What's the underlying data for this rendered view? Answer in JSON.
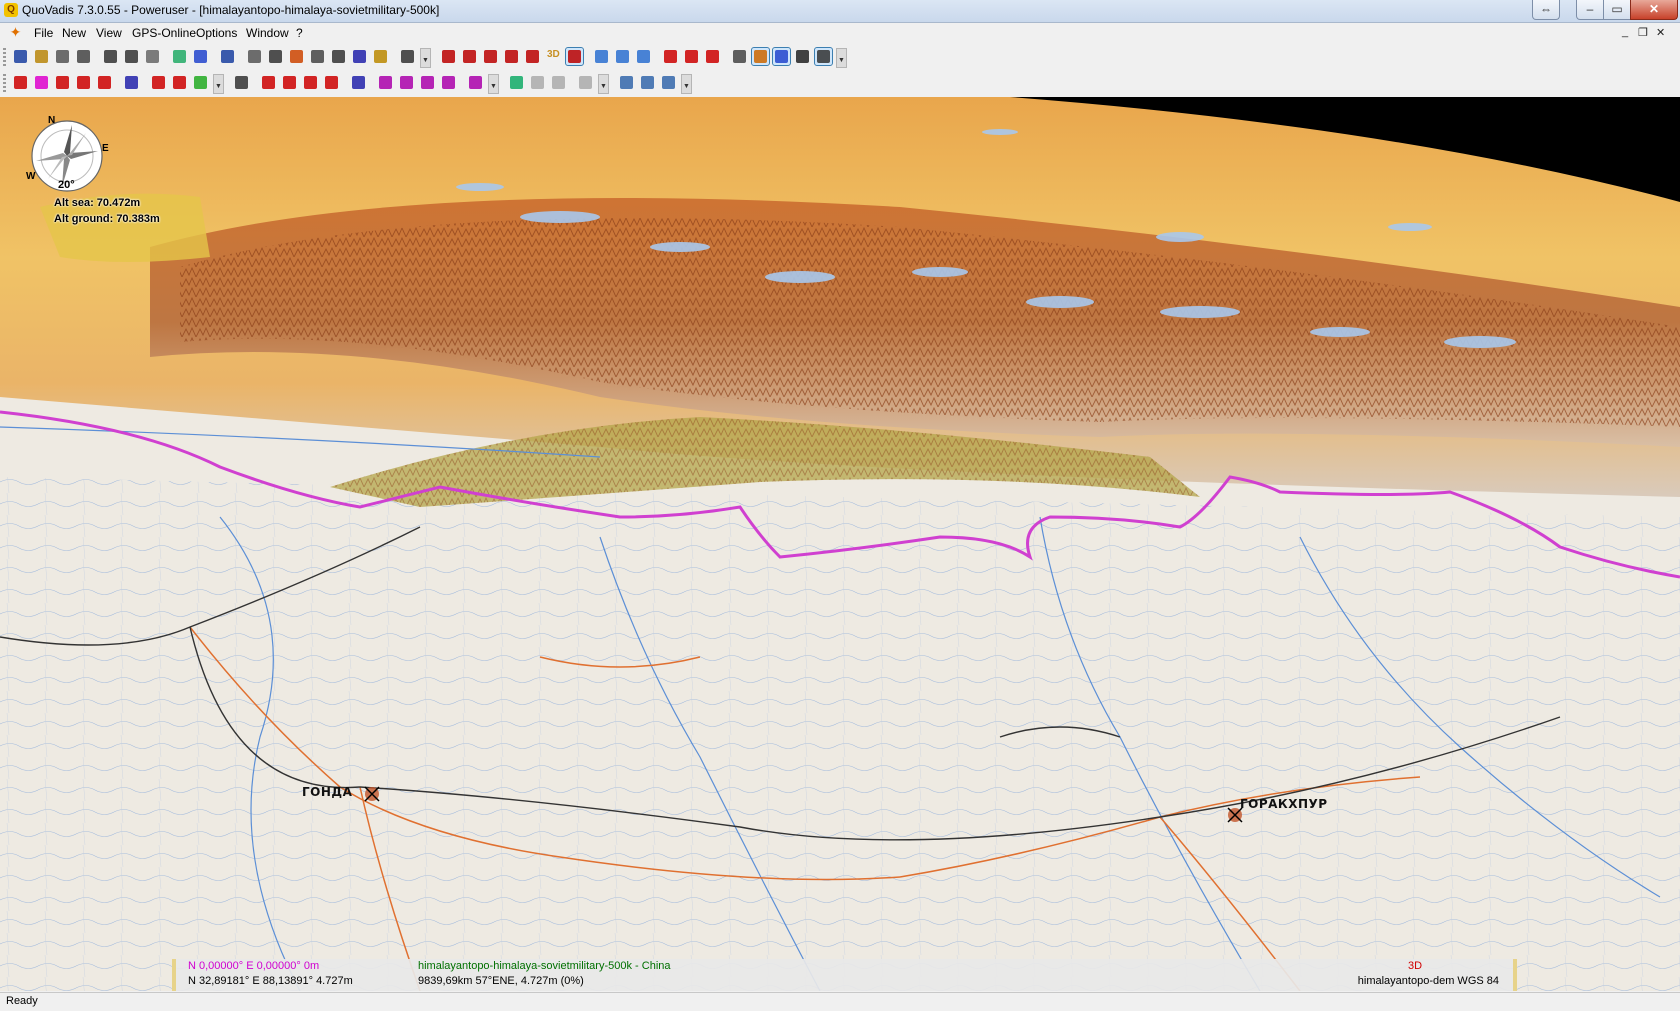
{
  "window": {
    "title": "QuoVadis 7.3.0.55 - Poweruser - [himalayantopo-himalaya-sovietmilitary-500k]",
    "controls": {
      "restore_ext": "⇔",
      "minimize": "–",
      "maximize": "▭",
      "close": "✕"
    }
  },
  "menu": {
    "items": [
      "File",
      "New",
      "View",
      "GPS-Online",
      "Options",
      "Window",
      "?"
    ],
    "mdi_controls": [
      "_",
      "❐",
      "✕"
    ]
  },
  "toolbar1": {
    "buttons": [
      {
        "icon": "delete-x-icon",
        "color": "#1a3fa0"
      },
      {
        "icon": "database-icon",
        "color": "#b8860b"
      },
      {
        "icon": "copy-icon",
        "color": "#555"
      },
      {
        "icon": "print-icon",
        "color": "#444"
      },
      {
        "icon": "binoculars-icon",
        "color": "#333"
      },
      {
        "icon": "binoculars-search-icon",
        "color": "#333"
      },
      {
        "icon": "export-icon",
        "color": "#666"
      },
      {
        "icon": "terrain-icon",
        "color": "#2a6"
      },
      {
        "icon": "dice-icon",
        "color": "#24c"
      },
      {
        "icon": "target-icon",
        "color": "#1a3fa0"
      },
      {
        "icon": "list-icon",
        "color": "#555"
      },
      {
        "icon": "layers-icon",
        "color": "#333"
      },
      {
        "icon": "route-icon",
        "color": "#c40"
      },
      {
        "icon": "clock-icon",
        "color": "#444"
      },
      {
        "icon": "notes-icon",
        "color": "#333"
      },
      {
        "icon": "gps-icon",
        "color": "#22a"
      },
      {
        "icon": "ruler-icon",
        "color": "#b80"
      },
      {
        "icon": "tools-icon",
        "color": "#333"
      },
      {
        "icon": "zoom-in-icon",
        "color": "#b00"
      },
      {
        "icon": "zoom-out-icon",
        "color": "#b00"
      },
      {
        "icon": "zoom-fit-icon",
        "color": "#b00"
      },
      {
        "icon": "zoom-window-icon",
        "color": "#b00"
      },
      {
        "icon": "zoom-reset-icon",
        "color": "#b00"
      },
      {
        "icon": "3d-icon",
        "color": "#c08000"
      },
      {
        "icon": "zoom-active-icon",
        "color": "#b00"
      },
      {
        "icon": "back-icon",
        "color": "#2a6fd0"
      },
      {
        "icon": "forward-icon",
        "color": "#2a6fd0"
      },
      {
        "icon": "download-icon",
        "color": "#2a6fd0"
      },
      {
        "icon": "add-marker-icon",
        "color": "#c00"
      },
      {
        "icon": "remove-marker-icon",
        "color": "#c00"
      },
      {
        "icon": "edit-marker-icon",
        "color": "#c00"
      },
      {
        "icon": "person-icon",
        "color": "#444"
      },
      {
        "icon": "draw-icon",
        "color": "#c60"
      },
      {
        "icon": "compass-icon",
        "color": "#24c"
      },
      {
        "icon": "grid-icon",
        "color": "#222"
      },
      {
        "icon": "window-icon",
        "color": "#333"
      }
    ]
  },
  "toolbar2": {
    "buttons": [
      {
        "icon": "waypoint-icon",
        "color": "#c00"
      },
      {
        "icon": "waypoint-edit-icon",
        "color": "#d0c"
      },
      {
        "icon": "waypoint-move-icon",
        "color": "#c00"
      },
      {
        "icon": "waypoint-copy-icon",
        "color": "#c00"
      },
      {
        "icon": "waypoint-delete-icon",
        "color": "#c00"
      },
      {
        "icon": "function-icon",
        "color": "#22a"
      },
      {
        "icon": "route-back-icon",
        "color": "#c00"
      },
      {
        "icon": "route-forward-icon",
        "color": "#c00"
      },
      {
        "icon": "palette-icon",
        "color": "#2a2"
      },
      {
        "icon": "find-icon",
        "color": "#333"
      },
      {
        "icon": "track-cut-icon",
        "color": "#c00"
      },
      {
        "icon": "track-join-icon",
        "color": "#c00"
      },
      {
        "icon": "track-split-icon",
        "color": "#c00"
      },
      {
        "icon": "track-delete-icon",
        "color": "#c00"
      },
      {
        "icon": "track-filter-icon",
        "color": "#22a"
      },
      {
        "icon": "track-tool1-icon",
        "color": "#a0a"
      },
      {
        "icon": "track-tool2-icon",
        "color": "#a0a"
      },
      {
        "icon": "track-tool3-icon",
        "color": "#a0a"
      },
      {
        "icon": "track-tool4-icon",
        "color": "#a0a"
      },
      {
        "icon": "track-tool5-icon",
        "color": "#a0a"
      },
      {
        "icon": "layers-color-icon",
        "color": "#1a6"
      },
      {
        "icon": "disabled-1-icon",
        "color": "#aaa"
      },
      {
        "icon": "disabled-2-icon",
        "color": "#aaa"
      },
      {
        "icon": "disabled-3-icon",
        "color": "#aaa"
      },
      {
        "icon": "globe-icon",
        "color": "#36a"
      },
      {
        "icon": "globe-search-icon",
        "color": "#36a"
      },
      {
        "icon": "globe-settings-icon",
        "color": "#36a"
      }
    ]
  },
  "overlay": {
    "compass": {
      "n": "N",
      "e": "E",
      "w": "W",
      "tilt": "20°"
    },
    "alt_sea": "Alt sea: 70.472m",
    "alt_ground": "Alt ground: 70.383m"
  },
  "map_labels": {
    "city_left": "ГОНДА",
    "city_right": "ГОРАКХПУР"
  },
  "info_panel": {
    "cursor": "N 0,00000°  E 0,00000°  0m",
    "position": "N 32,89181°  E 88,13891°  4.727m",
    "map_name": "himalayantopo-himalaya-sovietmilitary-500k - China",
    "distance": "9839,69km 57°ENE,  4.727m (0%)",
    "mode": "3D",
    "dem": "himalayantopo-dem  WGS 84"
  },
  "statusbar": {
    "text": "Ready"
  },
  "colors": {
    "border_line": "#d040d0",
    "road": "#e07030",
    "river": "#5c8fd6",
    "accent": "#3c7fb1"
  }
}
